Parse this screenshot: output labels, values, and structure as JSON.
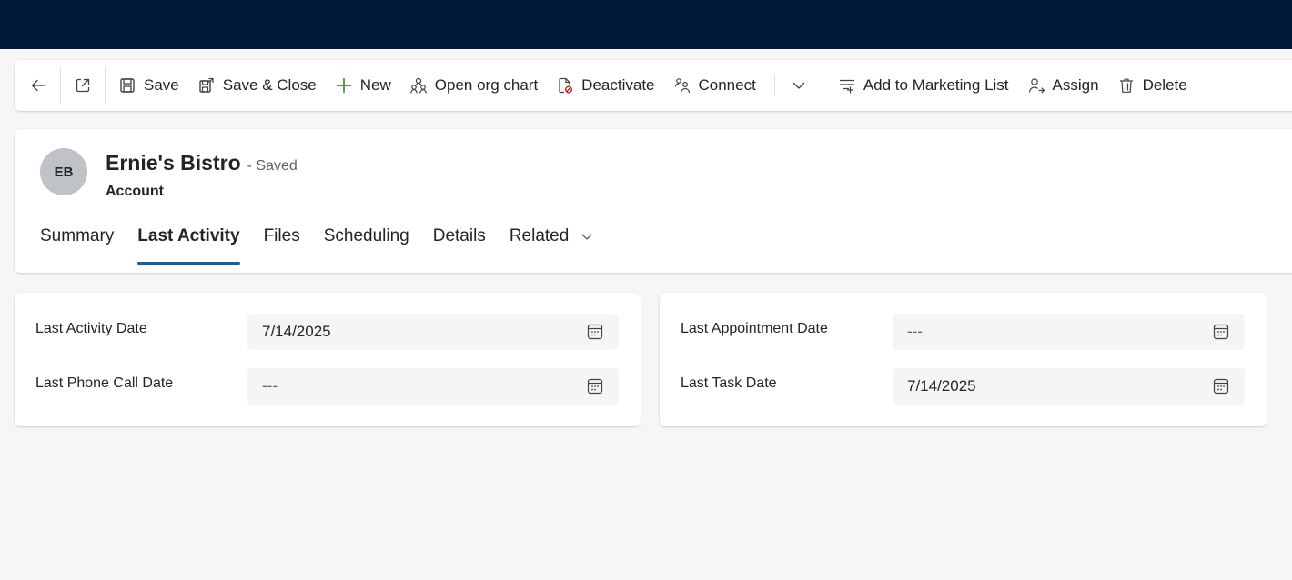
{
  "commandbar": {
    "save_label": "Save",
    "save_close_label": "Save & Close",
    "new_label": "New",
    "org_chart_label": "Open org chart",
    "deactivate_label": "Deactivate",
    "connect_label": "Connect",
    "marketing_label": "Add to Marketing List",
    "assign_label": "Assign",
    "delete_label": "Delete"
  },
  "record": {
    "initials": "EB",
    "title": "Ernie's Bistro",
    "status": "- Saved",
    "entity": "Account"
  },
  "tabs": [
    {
      "label": "Summary",
      "active": false
    },
    {
      "label": "Last Activity",
      "active": true
    },
    {
      "label": "Files",
      "active": false
    },
    {
      "label": "Scheduling",
      "active": false
    },
    {
      "label": "Details",
      "active": false
    },
    {
      "label": "Related",
      "active": false
    }
  ],
  "sections": {
    "left": [
      {
        "label": "Last Activity Date",
        "value": "7/14/2025"
      },
      {
        "label": "Last Phone Call Date",
        "value": "---"
      }
    ],
    "right": [
      {
        "label": "Last Appointment Date",
        "value": "---"
      },
      {
        "label": "Last Task Date",
        "value": "7/14/2025"
      }
    ]
  },
  "colors": {
    "topbar": "#011839",
    "accent": "#115ea3",
    "new_icon": "#107c10",
    "deactivate_badge": "#c50f1f"
  },
  "icons": [
    "back-arrow-icon",
    "popout-icon",
    "save-icon",
    "save-close-icon",
    "plus-icon",
    "org-chart-icon",
    "deactivate-icon",
    "connect-icon",
    "chevron-down-icon",
    "marketing-list-icon",
    "assign-icon",
    "delete-icon",
    "calendar-icon"
  ]
}
